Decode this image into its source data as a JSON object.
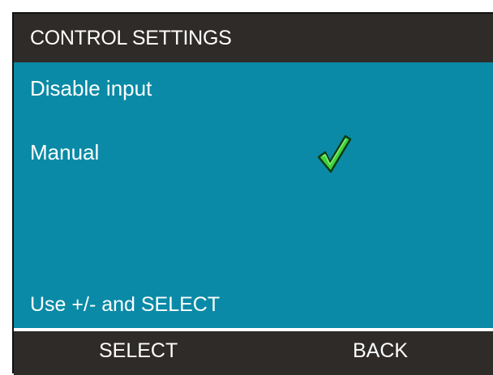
{
  "header": {
    "title": "CONTROL SETTINGS"
  },
  "menu": {
    "items": [
      {
        "label": "Disable input",
        "selected": false
      },
      {
        "label": "Manual",
        "selected": true
      }
    ]
  },
  "hint": "Use +/- and SELECT",
  "softkeys": {
    "left_label": "SELECT",
    "right_label": "BACK"
  },
  "icons": {
    "selected_marker": "checkmark-icon"
  },
  "colors": {
    "screen_background": "#0a8aa6",
    "bar_background": "#2e2b29",
    "text": "#ffffff",
    "checkmark_fill": "#3fd23a",
    "checkmark_outline": "#0b3d12"
  }
}
